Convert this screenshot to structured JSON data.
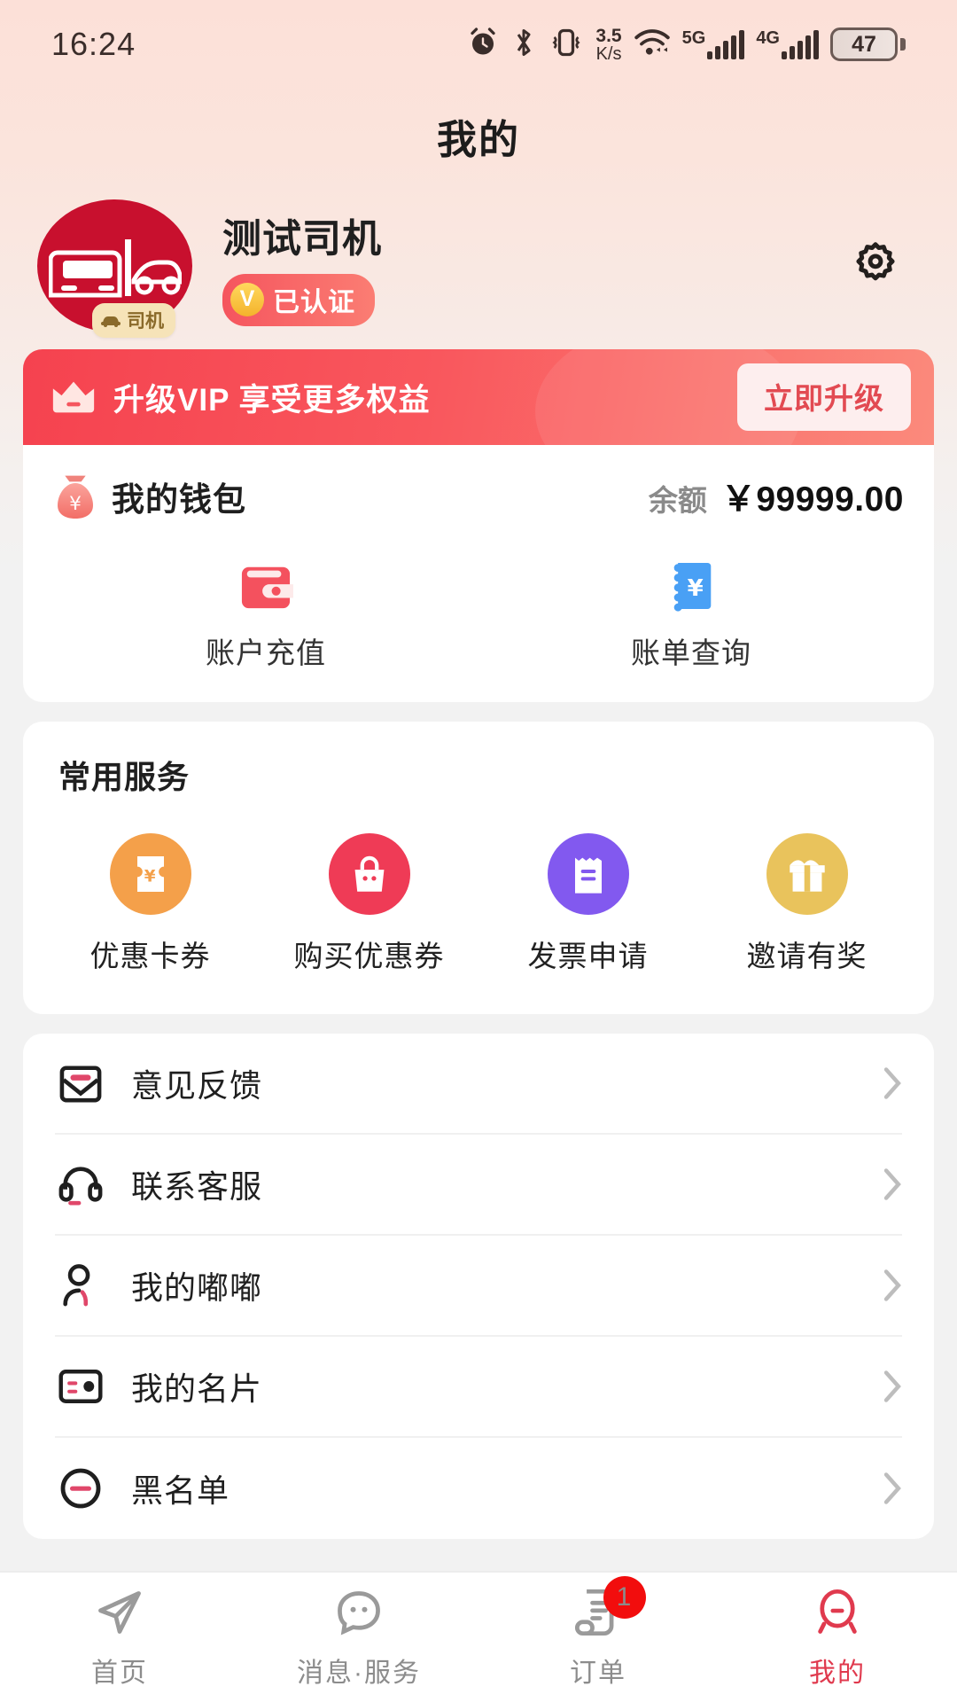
{
  "statusbar": {
    "time": "16:24",
    "net_speed_value": "3.5",
    "net_speed_unit": "K/s",
    "sim1_label": "5G",
    "sim2_label": "4G",
    "battery_percent": "47",
    "icons": [
      "alarm-icon",
      "bluetooth-icon",
      "vibrate-icon",
      "wifi-icon",
      "signal-icon",
      "battery-icon"
    ]
  },
  "header": {
    "title": "我的"
  },
  "profile": {
    "name": "测试司机",
    "verified_label": "已认证",
    "verified_mark": "V",
    "role_tag": "司机",
    "settings_icon": "gear-icon"
  },
  "vip": {
    "text": "升级VIP 享受更多权益",
    "button": "立即升级",
    "icon": "crown-icon",
    "color": "#f5424f"
  },
  "wallet": {
    "title": "我的钱包",
    "icon": "money-bag-icon",
    "balance_label": "余额",
    "balance_amount": "￥99999.00",
    "actions": [
      {
        "label": "账户充值",
        "icon": "wallet-icon",
        "color": "#f4515e"
      },
      {
        "label": "账单查询",
        "icon": "bill-yen-icon",
        "color": "#49a0f5"
      }
    ]
  },
  "services": {
    "title": "常用服务",
    "items": [
      {
        "label": "优惠卡券",
        "icon": "coupon-icon",
        "color": "#f4a04a"
      },
      {
        "label": "购买优惠券",
        "icon": "shopping-bag-icon",
        "color": "#ef3b56"
      },
      {
        "label": "发票申请",
        "icon": "invoice-icon",
        "color": "#8259ef"
      },
      {
        "label": "邀请有奖",
        "icon": "gift-icon",
        "color": "#e9c35c"
      }
    ]
  },
  "menu": {
    "items": [
      {
        "label": "意见反馈",
        "icon": "envelope-icon"
      },
      {
        "label": "联系客服",
        "icon": "headset-icon"
      },
      {
        "label": "我的嘟嘟",
        "icon": "person-icon"
      },
      {
        "label": "我的名片",
        "icon": "id-card-icon"
      },
      {
        "label": "黑名单",
        "icon": "block-circle-icon"
      }
    ]
  },
  "tabbar": {
    "active_color": "#e03a4e",
    "items": [
      {
        "label": "首页",
        "icon": "paper-plane-icon",
        "active": false,
        "badge": ""
      },
      {
        "label": "消息·服务",
        "icon": "chat-bubble-icon",
        "active": false,
        "badge": ""
      },
      {
        "label": "订单",
        "icon": "order-receipt-icon",
        "active": false,
        "badge": "1"
      },
      {
        "label": "我的",
        "icon": "user-face-icon",
        "active": true,
        "badge": ""
      }
    ]
  }
}
